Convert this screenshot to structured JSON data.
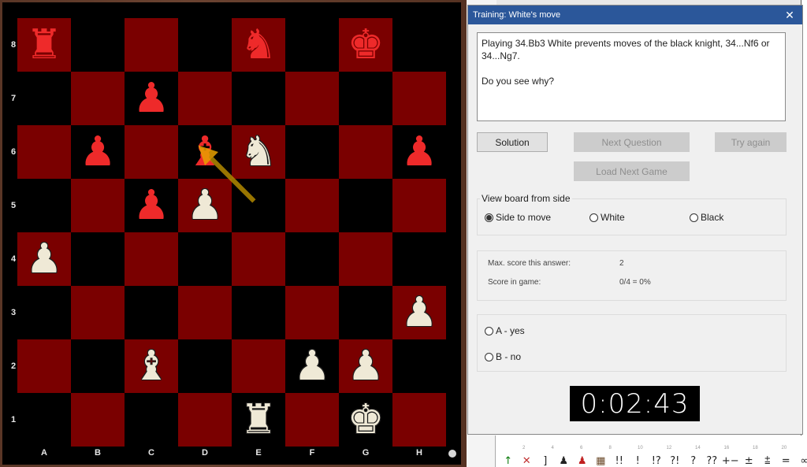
{
  "board": {
    "files": [
      "A",
      "B",
      "C",
      "D",
      "E",
      "F",
      "G",
      "H"
    ],
    "ranks": [
      "8",
      "7",
      "6",
      "5",
      "4",
      "3",
      "2",
      "1"
    ],
    "colors": {
      "light_square": "#7a0000",
      "dark_square": "#000000",
      "white_piece": "#efe9d6",
      "black_piece": "#ee2a2a",
      "arrow": "#b38a00"
    },
    "pieces": [
      {
        "square": "a8",
        "color": "b",
        "type": "rook",
        "glyph": "♜"
      },
      {
        "square": "e8",
        "color": "b",
        "type": "knight",
        "glyph": "♞"
      },
      {
        "square": "g8",
        "color": "b",
        "type": "king",
        "glyph": "♚"
      },
      {
        "square": "c7",
        "color": "b",
        "type": "pawn",
        "glyph": "♟"
      },
      {
        "square": "b6",
        "color": "b",
        "type": "pawn",
        "glyph": "♟"
      },
      {
        "square": "d6",
        "color": "b",
        "type": "bishop",
        "glyph": "♝"
      },
      {
        "square": "e6",
        "color": "w",
        "type": "knight",
        "glyph": "♞"
      },
      {
        "square": "h6",
        "color": "b",
        "type": "pawn",
        "glyph": "♟"
      },
      {
        "square": "c5",
        "color": "b",
        "type": "pawn",
        "glyph": "♟"
      },
      {
        "square": "d5",
        "color": "w",
        "type": "pawn",
        "glyph": "♟"
      },
      {
        "square": "a4",
        "color": "w",
        "type": "pawn",
        "glyph": "♟"
      },
      {
        "square": "h3",
        "color": "w",
        "type": "pawn",
        "glyph": "♟"
      },
      {
        "square": "c2",
        "color": "w",
        "type": "bishop",
        "glyph": "♝"
      },
      {
        "square": "f2",
        "color": "w",
        "type": "pawn",
        "glyph": "♟"
      },
      {
        "square": "g2",
        "color": "w",
        "type": "pawn",
        "glyph": "♟"
      },
      {
        "square": "e1",
        "color": "w",
        "type": "rook",
        "glyph": "♜"
      },
      {
        "square": "g1",
        "color": "w",
        "type": "king",
        "glyph": "♚"
      }
    ],
    "arrow": {
      "from": "e5",
      "to": "d6"
    },
    "side_to_move": "white"
  },
  "dialog": {
    "title": "Training: White's move",
    "close_icon": "close-icon",
    "message_line1": "Playing 34.Bb3 White prevents moves of the black knight, 34...Nf6 or 34...Ng7.",
    "message_line2": "Do you see why?",
    "buttons": {
      "solution": "Solution",
      "next_question": "Next Question",
      "try_again": "Try again",
      "load_next_game": "Load Next Game"
    },
    "view_side": {
      "title": "View board from side",
      "options": [
        "Side to move",
        "White",
        "Black"
      ],
      "selected": "Side to move"
    },
    "score": {
      "max_label": "Max. score this answer:",
      "max_value": "2",
      "game_label": "Score in game:",
      "game_value": "0/4 =  0%"
    },
    "answers": [
      "A - yes",
      "B - no"
    ],
    "timer": "0:02:43"
  },
  "bottom_panel": {
    "axis_ticks": [
      "2",
      "4",
      "6",
      "8",
      "10",
      "12",
      "14",
      "16",
      "18",
      "20"
    ],
    "annotations": [
      {
        "name": "arrow-up-icon",
        "glyph": "↑",
        "color": "#0a7a0a"
      },
      {
        "name": "delete-icon",
        "glyph": "✕",
        "color": "#c03030"
      },
      {
        "name": "bracket-icon",
        "glyph": "]",
        "color": "#222222"
      },
      {
        "name": "black-piece-icon",
        "glyph": "♟",
        "color": "#222222"
      },
      {
        "name": "red-piece-icon",
        "glyph": "♟",
        "color": "#c02020"
      },
      {
        "name": "board-icon",
        "glyph": "▦",
        "color": "#6b4a2a"
      },
      {
        "name": "brilliant-icon",
        "glyph": "!!",
        "color": "#222222"
      },
      {
        "name": "good-icon",
        "glyph": "!",
        "color": "#222222"
      },
      {
        "name": "interesting-icon",
        "glyph": "!?",
        "color": "#222222"
      },
      {
        "name": "dubious-icon",
        "glyph": "?!",
        "color": "#222222"
      },
      {
        "name": "mistake-icon",
        "glyph": "?",
        "color": "#222222"
      },
      {
        "name": "blunder-icon",
        "glyph": "??",
        "color": "#222222"
      },
      {
        "name": "white-winning-icon",
        "glyph": "+−",
        "color": "#222222"
      },
      {
        "name": "white-better-icon",
        "glyph": "±",
        "color": "#222222"
      },
      {
        "name": "white-slightly-better-icon",
        "glyph": "⩲",
        "color": "#222222"
      },
      {
        "name": "equal-icon",
        "glyph": "=",
        "color": "#222222"
      },
      {
        "name": "unclear-icon",
        "glyph": "∞",
        "color": "#222222"
      }
    ]
  }
}
